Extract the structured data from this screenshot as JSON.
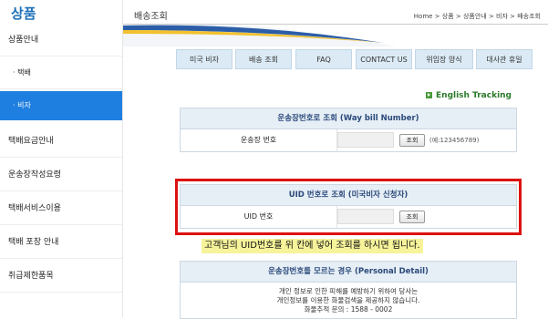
{
  "sidebar": {
    "title": "상품",
    "items": [
      {
        "label": "상품안내"
      },
      {
        "label": "· 택배"
      },
      {
        "label": "· 비자"
      },
      {
        "label": "택배요금안내"
      },
      {
        "label": "운송장작성요령"
      },
      {
        "label": "택배서비스이용"
      },
      {
        "label": "택배 포장 안내"
      },
      {
        "label": "취급제한품목"
      }
    ]
  },
  "header": {
    "title": "배송조회",
    "breadcrumb": "Home > 상품 > 상품안내 > 비자 > 배송조회"
  },
  "tabs": [
    {
      "label": "미국 비자"
    },
    {
      "label": "배송 조회"
    },
    {
      "label": "FAQ"
    },
    {
      "label": "CONTACT US"
    },
    {
      "label": "위임장 양식"
    },
    {
      "label": "대사관 휴일"
    }
  ],
  "english_tracking": "English Tracking",
  "waybill": {
    "title": "운송장번호로 조회 (Way bill Number)",
    "label": "운송장 번호",
    "button": "조회",
    "hint": "(예:123456789)"
  },
  "uid": {
    "title": "UID 번호로 조회 (미국비자 신청자)",
    "label": "UID 번호",
    "button": "조회"
  },
  "notice": "고객님의 UID번호를 위 칸에 넣어 조회를 하시면 됩니다.",
  "personal": {
    "title": "운송장번호를 모르는 경우 (Personal Detail)",
    "line1": "개인 정보로 인한 피해를 예방하기 위하여 당사는",
    "line2": "개인정보를 이용한 화물검색을 제공하지 않습니다.",
    "line3": "화물추적 문의 : 1588 - 0002"
  },
  "colors": {
    "accent": "#1f7fe0",
    "highlight_frame": "#dd1111",
    "notice_bg": "#f6f39a"
  }
}
